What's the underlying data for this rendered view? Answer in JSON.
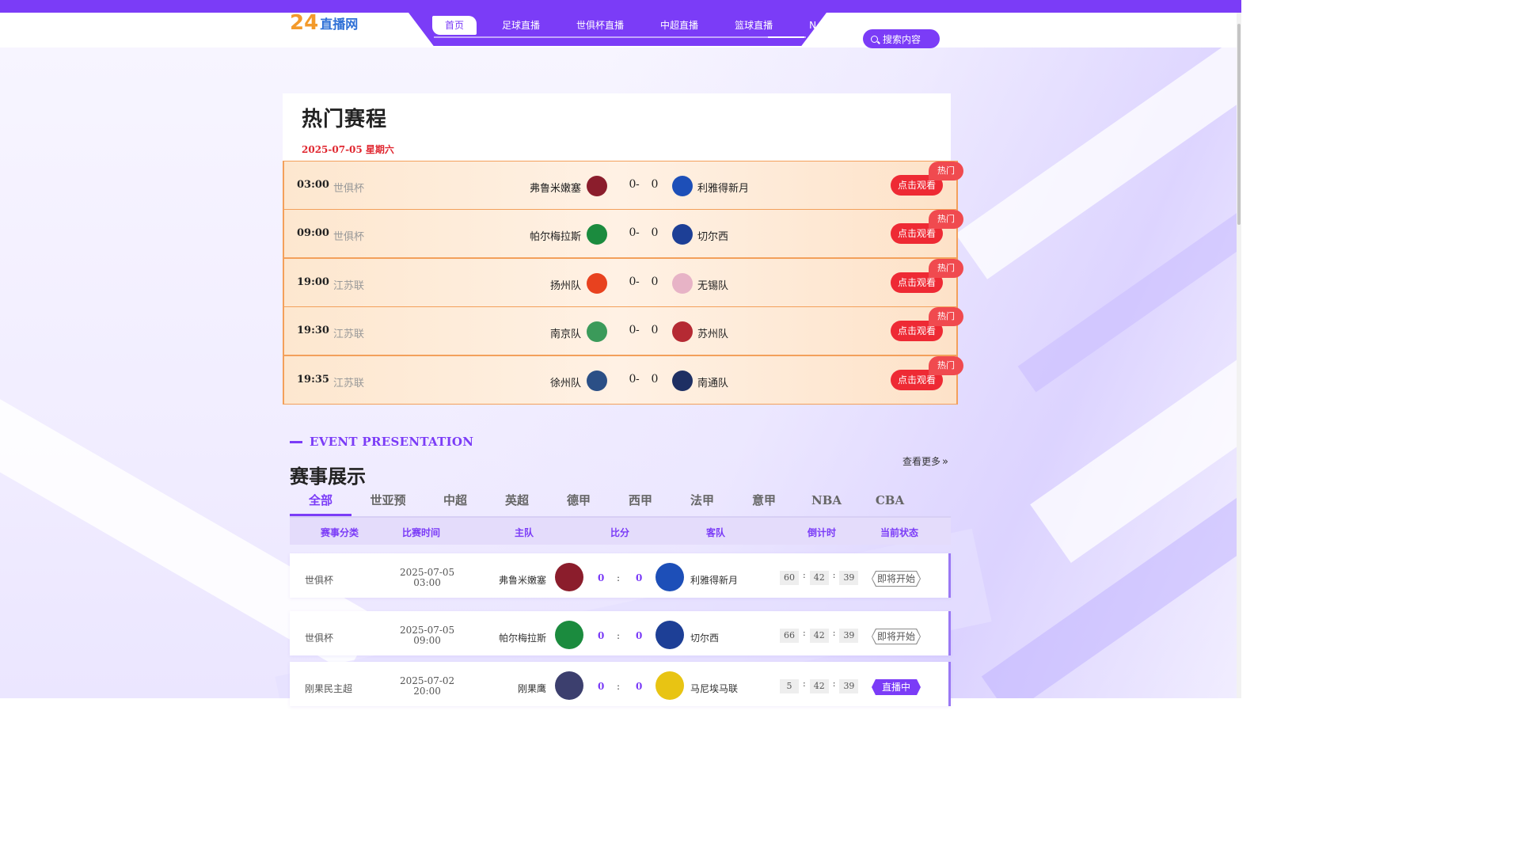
{
  "logo": {
    "number": "24",
    "text": "直播网"
  },
  "nav": {
    "items": [
      {
        "label": "首页"
      },
      {
        "label": "足球直播"
      },
      {
        "label": "世俱杯直播"
      },
      {
        "label": "中超直播"
      },
      {
        "label": "篮球直播"
      },
      {
        "label": "N"
      }
    ]
  },
  "search": {
    "placeholder": "搜索内容"
  },
  "hot": {
    "title": "热门赛程",
    "date": "2025-07-05 星期六",
    "button_label": "点击观看",
    "badge_label": "热门",
    "rows": [
      {
        "time": "03:00",
        "league": "世俱杯",
        "home": "弗鲁米嫩塞",
        "away": "利雅得新月",
        "home_score": "0",
        "away_score": "0",
        "home_color": "#8b1d2c",
        "away_color": "#1d4fb8"
      },
      {
        "time": "09:00",
        "league": "世俱杯",
        "home": "帕尔梅拉斯",
        "away": "切尔西",
        "home_score": "0",
        "away_score": "0",
        "home_color": "#1b8b3e",
        "away_color": "#1d3f96"
      },
      {
        "time": "19:00",
        "league": "江苏联",
        "home": "扬州队",
        "away": "无锡队",
        "home_score": "0",
        "away_score": "0",
        "home_color": "#e8421f",
        "away_color": "#e7b3c6"
      },
      {
        "time": "19:30",
        "league": "江苏联",
        "home": "南京队",
        "away": "苏州队",
        "home_score": "0",
        "away_score": "0",
        "home_color": "#3b9a5a",
        "away_color": "#b52a33"
      },
      {
        "time": "19:35",
        "league": "江苏联",
        "home": "徐州队",
        "away": "南通队",
        "home_score": "0",
        "away_score": "0",
        "home_color": "#2b4f86",
        "away_color": "#1e2f63"
      }
    ]
  },
  "events": {
    "en_title": "EVENT PRESENTATION",
    "title": "赛事展示",
    "more_label": "查看更多",
    "tabs": [
      "全部",
      "世亚预",
      "中超",
      "英超",
      "德甲",
      "西甲",
      "法甲",
      "意甲",
      "NBA",
      "CBA"
    ],
    "columns": [
      "赛事分类",
      "比赛时间",
      "主队",
      "比分",
      "客队",
      "倒计时",
      "当前状态"
    ],
    "rows": [
      {
        "league": "世俱杯",
        "date": "2025-07-05",
        "time": "03:00",
        "home": "弗鲁米嫩塞",
        "home_score": "0",
        "sep": ":",
        "away_score": "0",
        "away": "利雅得新月",
        "cd": [
          "60",
          "42",
          "39"
        ],
        "status": "即将开始",
        "status_type": "wait",
        "home_color": "#8b1d2c",
        "away_color": "#1d4fb8"
      },
      {
        "league": "世俱杯",
        "date": "2025-07-05",
        "time": "09:00",
        "home": "帕尔梅拉斯",
        "home_score": "0",
        "sep": ":",
        "away_score": "0",
        "away": "切尔西",
        "cd": [
          "66",
          "42",
          "39"
        ],
        "status": "即将开始",
        "status_type": "wait",
        "home_color": "#1b8b3e",
        "away_color": "#1d3f96"
      },
      {
        "league": "刚果民主超",
        "date": "2025-07-02",
        "time": "20:00",
        "home": "刚果鹰",
        "home_score": "0",
        "sep": ":",
        "away_score": "0",
        "away": "马尼埃马联",
        "cd": [
          "5",
          "42",
          "39"
        ],
        "status": "直播中",
        "status_type": "live",
        "home_color": "#3c3f6e",
        "away_color": "#e8c413"
      }
    ]
  },
  "colors": {
    "accent": "#7b3cf7",
    "hot_red": "#ee2a34",
    "hot_border": "#f3a05b"
  }
}
